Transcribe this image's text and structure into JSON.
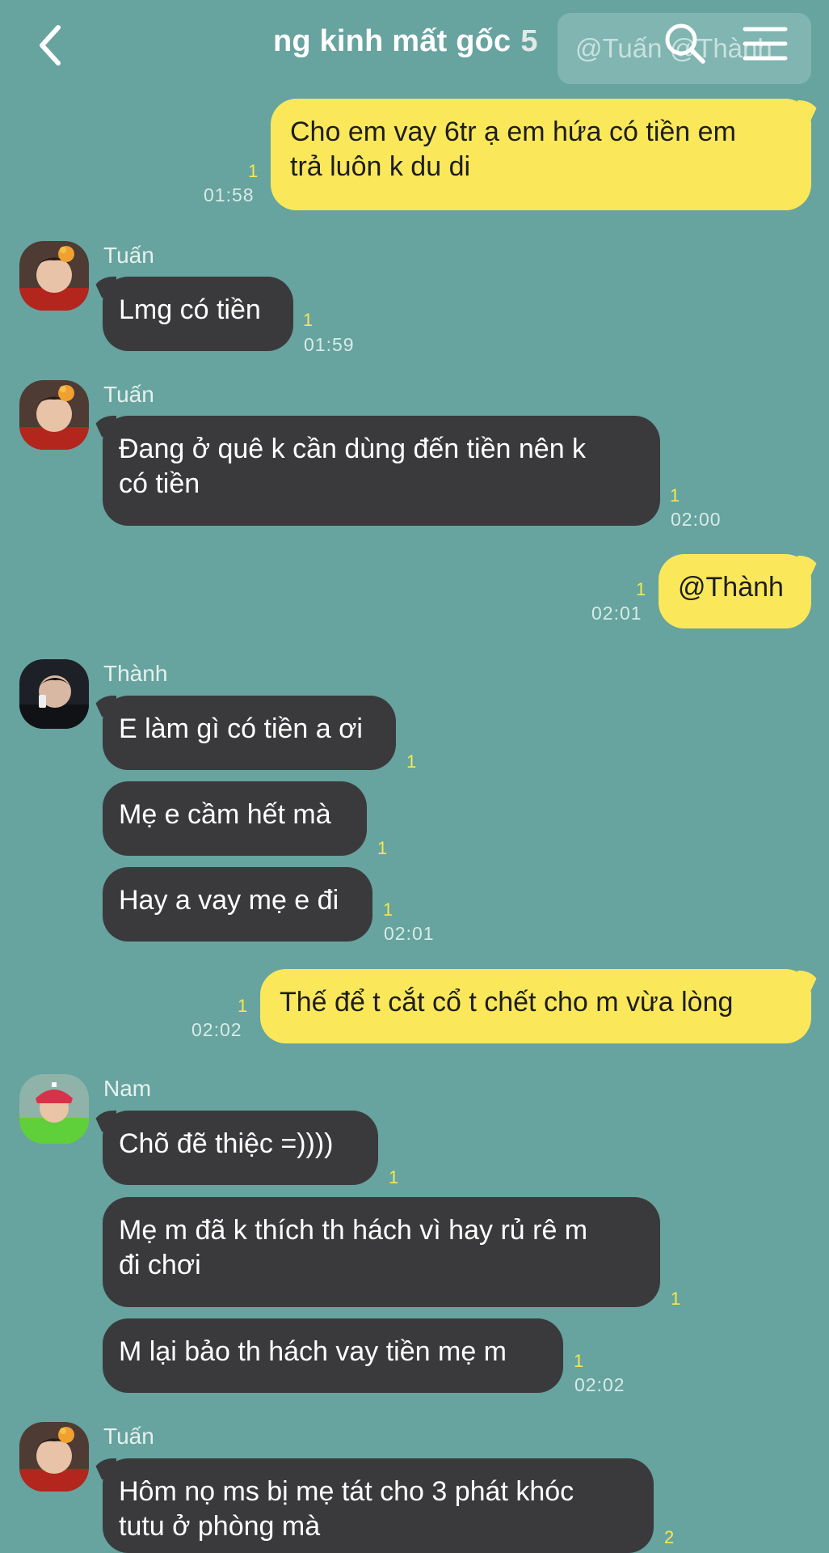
{
  "header": {
    "title": "ng kinh mất gốc",
    "member_count": "5",
    "mention_preview": "@Tuấn @Thành",
    "back_icon": "chevron-left-icon",
    "search_icon": "search-icon",
    "menu_icon": "hamburger-menu-icon"
  },
  "colors": {
    "background": "#67a39f",
    "incoming_bubble": "#3a3a3c",
    "outgoing_bubble": "#fae85a",
    "read_count": "#f7e84d"
  },
  "messages": [
    {
      "text_lines": [
        "Cho em vay 6tr ạ em hứa có tiền em",
        "trả luôn k du di"
      ],
      "read_count": "1",
      "time": "01:58"
    },
    {
      "sender": "Tuấn",
      "text": "Lmg có tiền",
      "read_count": "1",
      "time": "01:59"
    },
    {
      "sender": "Tuấn",
      "text_lines": [
        "Đang ở quê k cần dùng đến tiền nên k",
        "có tiền"
      ],
      "read_count": "1",
      "time": "02:00"
    },
    {
      "text": "@Thành",
      "read_count": "1",
      "time": "02:01"
    },
    {
      "sender": "Thành",
      "text": "E làm gì có tiền a ơi",
      "read_count": "1"
    },
    {
      "text": "Mẹ e cầm hết mà",
      "read_count": "1"
    },
    {
      "text": "Hay a vay mẹ e đi",
      "read_count": "1",
      "time": "02:01"
    },
    {
      "text": "Thế để t cắt cổ t chết cho m vừa lòng",
      "read_count": "1",
      "time": "02:02"
    },
    {
      "sender": "Nam",
      "text": "Chõ đẽ thiệc =))))",
      "read_count": "1"
    },
    {
      "text_lines": [
        "Mẹ m đã k thích th hách vì hay rủ rê m",
        "đi chơi"
      ],
      "read_count": "1"
    },
    {
      "text": "M lại bảo th hách vay tiền mẹ m",
      "read_count": "1",
      "time": "02:02"
    },
    {
      "sender": "Tuấn",
      "text_lines": [
        "Hôm nọ ms bị mẹ tát cho 3 phát khóc",
        "tutu ở phòng mà"
      ],
      "read_count": "2"
    }
  ]
}
